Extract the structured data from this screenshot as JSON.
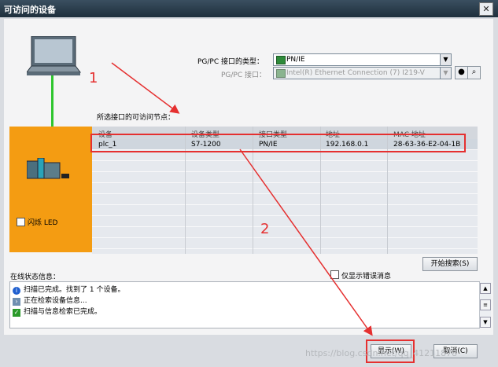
{
  "window": {
    "title": "可访问的设备",
    "close_label": "✕"
  },
  "interface": {
    "type_label": "PG/PC 接口的类型：",
    "type_value": "PN/IE",
    "iface_label": "PG/PC 接口：",
    "iface_value": "Intel(R) Ethernet Connection (7) I219-V"
  },
  "nodes_label": "所选接口的可访问节点：",
  "table": {
    "headers": [
      "设备",
      "设备类型",
      "接口类型",
      "地址",
      "MAC 地址"
    ],
    "rows": [
      [
        "plc_1",
        "S7-1200",
        "PN/IE",
        "192.168.0.1",
        "28-63-36-E2-04-1B"
      ]
    ]
  },
  "flash_led_label": "闪烁 LED",
  "start_search_label": "开始搜索(S)",
  "status": {
    "title": "在线状态信息：",
    "only_errors_label": "仅显示错误消息",
    "messages": [
      {
        "icon": "info-icon",
        "text": "扫描已完成。找到了 1 个设备。"
      },
      {
        "icon": "search-icon",
        "text": "正在检索设备信息..."
      },
      {
        "icon": "check-icon",
        "text": "扫描与信息检索已完成。"
      }
    ]
  },
  "footer": {
    "show_label": "显示(W)",
    "cancel_label": "取消(C)",
    "watermark": "https://blog.csdn.net/qq_41211878"
  },
  "annotations": {
    "marker_1": "1",
    "marker_2": "2"
  },
  "colors": {
    "accent": "#f49c12",
    "highlight": "#e53030",
    "title_bar": "#2b3d4c"
  }
}
